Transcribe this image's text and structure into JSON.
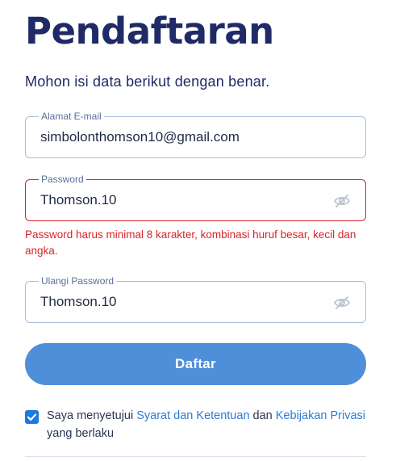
{
  "header": {
    "title": "Pendaftaran",
    "subtitle": "Mohon isi data berikut dengan benar."
  },
  "form": {
    "email": {
      "label": "Alamat E-mail",
      "value": "simbolonthomson10@gmail.com"
    },
    "password": {
      "label": "Password",
      "value": "Thomson.10",
      "state": "error"
    },
    "password_error": "Password harus minimal 8 karakter, kombinasi huruf besar, kecil dan angka.",
    "confirm_password": {
      "label": "Ulangi Password",
      "value": "Thomson.10"
    },
    "submit_label": "Daftar"
  },
  "agreement": {
    "checked": true,
    "text_before": "Saya menyetujui ",
    "terms_link": "Syarat dan Ketentuan",
    "text_middle": " dan ",
    "privacy_link": "Kebijakan Privasi",
    "text_after": " yang berlaku"
  },
  "icons": {
    "password_toggle": "eye-off-icon",
    "checkbox": "check-icon"
  },
  "colors": {
    "title": "#1f2a66",
    "border": "#a9bedb",
    "error": "#d9232d",
    "button": "#4f8ed9",
    "link": "#2a7bd8",
    "checkbox": "#1a7ae0"
  }
}
